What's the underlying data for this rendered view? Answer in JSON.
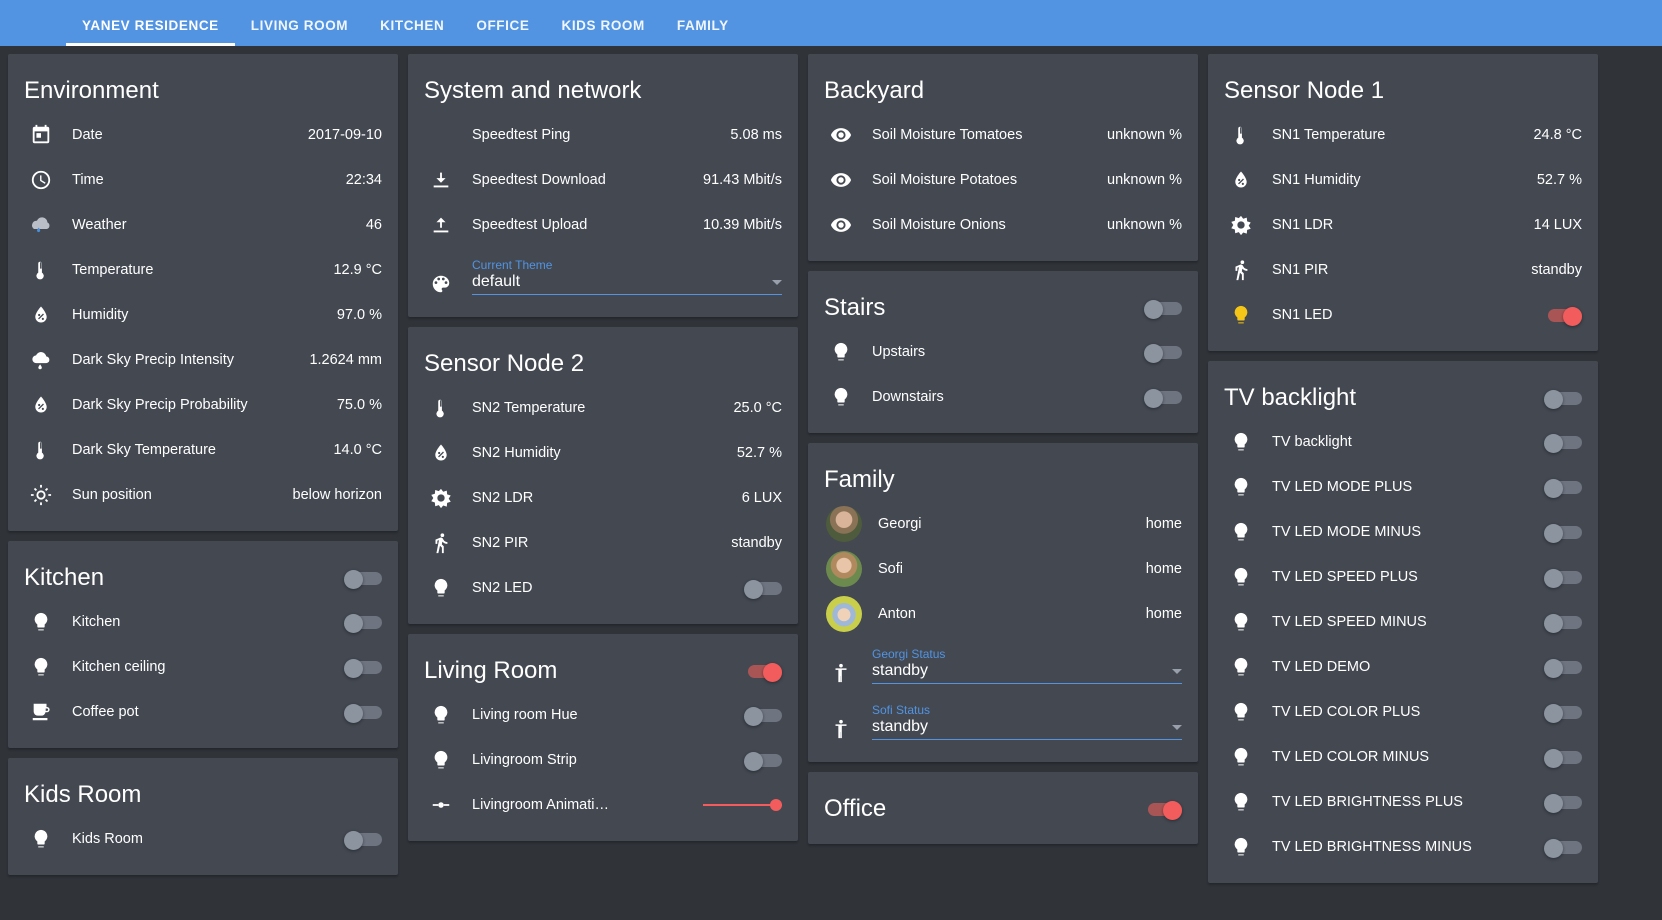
{
  "toolbar": {
    "tabs": [
      {
        "label": "YANEV RESIDENCE",
        "active": true
      },
      {
        "label": "LIVING ROOM",
        "active": false
      },
      {
        "label": "KITCHEN",
        "active": false
      },
      {
        "label": "OFFICE",
        "active": false
      },
      {
        "label": "KIDS ROOM",
        "active": false
      },
      {
        "label": "FAMILY",
        "active": false
      }
    ]
  },
  "colors": {
    "accent": "#5294E2",
    "card": "#434851",
    "background": "#303439",
    "toggle_on": "#F25C5C",
    "toggle_off": "#8C94A0",
    "slider": "#F25C5C",
    "led_on": "#F5C518"
  },
  "cards": {
    "environment": {
      "title": "Environment",
      "rows": [
        {
          "icon": "calendar-icon",
          "name": "Date",
          "value": "2017-09-10"
        },
        {
          "icon": "clock-icon",
          "name": "Time",
          "value": "22:34"
        },
        {
          "icon": "rainy-cloud-icon",
          "name": "Weather",
          "value": "46"
        },
        {
          "icon": "thermometer-icon",
          "name": "Temperature",
          "value": "12.9 °C"
        },
        {
          "icon": "water-percent-icon",
          "name": "Humidity",
          "value": "97.0 %"
        },
        {
          "icon": "rain-icon",
          "name": "Dark Sky Precip Intensity",
          "value": "1.2624 mm"
        },
        {
          "icon": "water-percent-icon",
          "name": "Dark Sky Precip Probability",
          "value": "75.0 %"
        },
        {
          "icon": "thermometer-icon",
          "name": "Dark Sky Temperature",
          "value": "14.0 °C"
        },
        {
          "icon": "sun-icon",
          "name": "Sun position",
          "value": "below horizon"
        }
      ]
    },
    "kitchen": {
      "title": "Kitchen",
      "header_toggle": false,
      "rows": [
        {
          "icon": "bulb-icon",
          "name": "Kitchen",
          "toggle": false
        },
        {
          "icon": "bulb-icon",
          "name": "Kitchen ceiling",
          "toggle": false
        },
        {
          "icon": "coffee-icon",
          "name": "Coffee pot",
          "toggle": false
        }
      ]
    },
    "kids_room": {
      "title": "Kids Room",
      "rows": [
        {
          "icon": "bulb-icon",
          "name": "Kids Room",
          "toggle": false
        }
      ]
    },
    "system_network": {
      "title": "System and network",
      "rows": [
        {
          "icon": "none",
          "name": "Speedtest Ping",
          "value": "5.08 ms"
        },
        {
          "icon": "download-icon",
          "name": "Speedtest Download",
          "value": "91.43 Mbit/s"
        },
        {
          "icon": "upload-icon",
          "name": "Speedtest Upload",
          "value": "10.39 Mbit/s"
        }
      ],
      "theme_select": {
        "icon": "palette-icon",
        "label": "Current Theme",
        "value": "default"
      }
    },
    "sensor_node_2": {
      "title": "Sensor Node 2",
      "rows": [
        {
          "icon": "thermometer-icon",
          "name": "SN2 Temperature",
          "value": "25.0 °C"
        },
        {
          "icon": "water-percent-icon",
          "name": "SN2 Humidity",
          "value": "52.7 %"
        },
        {
          "icon": "brightness-icon",
          "name": "SN2 LDR",
          "value": "6 LUX"
        },
        {
          "icon": "run-icon",
          "name": "SN2 PIR",
          "value": "standby"
        },
        {
          "icon": "bulb-icon",
          "name": "SN2 LED",
          "toggle": false
        }
      ]
    },
    "living_room": {
      "title": "Living Room",
      "header_toggle": true,
      "rows": [
        {
          "icon": "bulb-icon",
          "name": "Living room Hue",
          "toggle": false
        },
        {
          "icon": "bulb-icon",
          "name": "Livingroom Strip",
          "toggle": false
        },
        {
          "icon": "tune-icon",
          "name": "Livingroom Animati…",
          "slider": 100
        }
      ]
    },
    "backyard": {
      "title": "Backyard",
      "rows": [
        {
          "icon": "eye-icon",
          "name": "Soil Moisture Tomatoes",
          "value": "unknown %"
        },
        {
          "icon": "eye-icon",
          "name": "Soil Moisture Potatoes",
          "value": "unknown %"
        },
        {
          "icon": "eye-icon",
          "name": "Soil Moisture Onions",
          "value": "unknown %"
        }
      ]
    },
    "stairs": {
      "title": "Stairs",
      "header_toggle": false,
      "rows": [
        {
          "icon": "bulb-icon",
          "name": "Upstairs",
          "toggle": false
        },
        {
          "icon": "bulb-icon",
          "name": "Downstairs",
          "toggle": false
        }
      ]
    },
    "family": {
      "title": "Family",
      "people": [
        {
          "avatar": "av-georgi",
          "name": "Georgi",
          "value": "home"
        },
        {
          "avatar": "av-sofi",
          "name": "Sofi",
          "value": "home"
        },
        {
          "avatar": "av-anton",
          "name": "Anton",
          "value": "home"
        }
      ],
      "selects": [
        {
          "icon": "human-icon",
          "label": "Georgi Status",
          "value": "standby"
        },
        {
          "icon": "human-icon",
          "label": "Sofi Status",
          "value": "standby"
        }
      ]
    },
    "office": {
      "title": "Office",
      "header_toggle": true
    },
    "sensor_node_1": {
      "title": "Sensor Node 1",
      "rows": [
        {
          "icon": "thermometer-icon",
          "name": "SN1 Temperature",
          "value": "24.8 °C"
        },
        {
          "icon": "water-percent-icon",
          "name": "SN1 Humidity",
          "value": "52.7 %"
        },
        {
          "icon": "brightness-icon",
          "name": "SN1 LDR",
          "value": "14 LUX"
        },
        {
          "icon": "run-icon",
          "name": "SN1 PIR",
          "value": "standby"
        },
        {
          "icon": "bulb-on-icon",
          "name": "SN1 LED",
          "toggle": true
        }
      ]
    },
    "tv_backlight": {
      "title": "TV backlight",
      "header_toggle": false,
      "rows": [
        {
          "icon": "bulb-icon",
          "name": "TV backlight",
          "toggle": false
        },
        {
          "icon": "bulb-icon",
          "name": "TV LED MODE PLUS",
          "toggle": false
        },
        {
          "icon": "bulb-icon",
          "name": "TV LED MODE MINUS",
          "toggle": false
        },
        {
          "icon": "bulb-icon",
          "name": "TV LED SPEED PLUS",
          "toggle": false
        },
        {
          "icon": "bulb-icon",
          "name": "TV LED SPEED MINUS",
          "toggle": false
        },
        {
          "icon": "bulb-icon",
          "name": "TV LED DEMO",
          "toggle": false
        },
        {
          "icon": "bulb-icon",
          "name": "TV LED COLOR PLUS",
          "toggle": false
        },
        {
          "icon": "bulb-icon",
          "name": "TV LED COLOR MINUS",
          "toggle": false
        },
        {
          "icon": "bulb-icon",
          "name": "TV LED BRIGHTNESS PLUS",
          "toggle": false
        },
        {
          "icon": "bulb-icon",
          "name": "TV LED BRIGHTNESS MINUS",
          "toggle": false
        }
      ]
    }
  }
}
